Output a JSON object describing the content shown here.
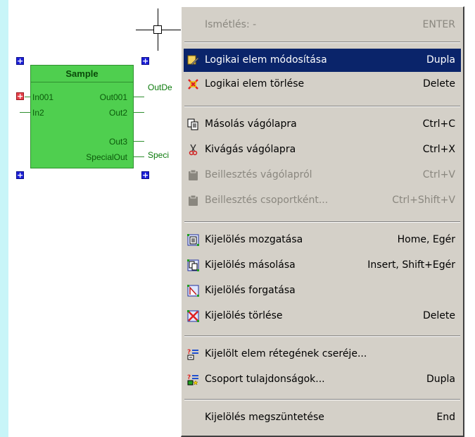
{
  "block": {
    "title": "Sample",
    "inputs": [
      "In001",
      "In2"
    ],
    "outputs": [
      "Out001",
      "Out2",
      "Out3",
      "SpecialOut"
    ],
    "ext_labels": [
      "OutDe",
      "Speci"
    ],
    "plus_symbol": "+"
  },
  "menu": {
    "items": [
      {
        "label": "Ismétlés: -",
        "shortcut": "ENTER",
        "icon": "none",
        "state": "disabled"
      },
      {
        "label": "Logikai elem módosítása",
        "shortcut": "Dupla",
        "icon": "edit-element-icon",
        "state": "selected"
      },
      {
        "label": "Logikai elem törlése",
        "shortcut": "Delete",
        "icon": "delete-element-icon",
        "state": "normal"
      },
      {
        "label": "Másolás vágólapra",
        "shortcut": "Ctrl+C",
        "icon": "copy-icon",
        "state": "normal"
      },
      {
        "label": "Kivágás vágólapra",
        "shortcut": "Ctrl+X",
        "icon": "scissors-icon",
        "state": "normal"
      },
      {
        "label": "Beillesztés vágólapról",
        "shortcut": "Ctrl+V",
        "icon": "paste-icon",
        "state": "disabled"
      },
      {
        "label": "Beillesztés csoportként...",
        "shortcut": "Ctrl+Shift+V",
        "icon": "paste-group-icon",
        "state": "disabled"
      },
      {
        "label": "Kijelölés mozgatása",
        "shortcut": "Home, Egér",
        "icon": "move-selection-icon",
        "state": "normal"
      },
      {
        "label": "Kijelölés másolása",
        "shortcut": "Insert, Shift+Egér",
        "icon": "copy-selection-icon",
        "state": "normal"
      },
      {
        "label": "Kijelölés forgatása",
        "shortcut": "",
        "icon": "rotate-selection-icon",
        "state": "normal"
      },
      {
        "label": "Kijelölés törlése",
        "shortcut": "Delete",
        "icon": "delete-selection-icon",
        "state": "normal"
      },
      {
        "label": "Kijelölt elem rétegének cseréje...",
        "shortcut": "",
        "icon": "layer-swap-icon",
        "state": "normal"
      },
      {
        "label": "Csoport tulajdonságok...",
        "shortcut": "Dupla",
        "icon": "group-properties-icon",
        "state": "normal"
      },
      {
        "label": "Kijelölés megszüntetése",
        "shortcut": "End",
        "icon": "none",
        "state": "normal"
      }
    ]
  },
  "colors": {
    "selection": "#0a246a",
    "menu_bg": "#d4d0c8",
    "block_fill": "#4fcf4f",
    "left_strip": "#c8f5f8"
  }
}
